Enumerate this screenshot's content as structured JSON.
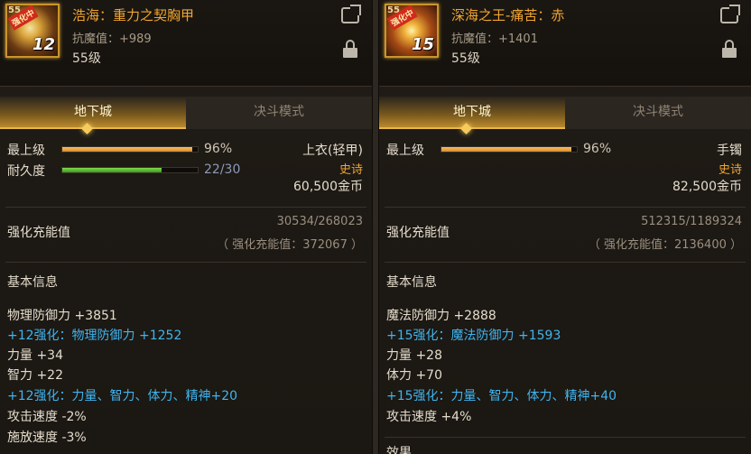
{
  "left": {
    "icon": {
      "tag": "强化中",
      "lvl": "55",
      "level": "12"
    },
    "name": "浩海：重力之契胸甲",
    "resistance": "抗魔值：+989",
    "required_level": "55级",
    "tabs": [
      "地下城",
      "决斗模式"
    ],
    "stats": {
      "top_level_label": "最上级",
      "top_level_percent": 0.96,
      "top_level_value": "96%",
      "durability_label": "耐久度",
      "durability_fraction": 0.7333,
      "durability_value": "22/30"
    },
    "slot": "上衣(轻甲)",
    "rarity": "史诗",
    "price": "60,500金币",
    "charge": {
      "label": "强化充能值",
      "progress": "30534/268023",
      "total": "（ 强化充能值：372067 ）"
    },
    "basic_info_title": "基本信息",
    "attributes": [
      {
        "text": "物理防御力 +3851",
        "color": "white"
      },
      {
        "text": "+12强化：物理防御力 +1252",
        "color": "blue"
      },
      {
        "text": "力量 +34",
        "color": "white"
      },
      {
        "text": "智力 +22",
        "color": "white"
      },
      {
        "text": "+12强化：力量、智力、体力、精神+20",
        "color": "blue"
      },
      {
        "text": "攻击速度 -2%",
        "color": "white"
      },
      {
        "text": "施放速度 -3%",
        "color": "white"
      }
    ]
  },
  "right": {
    "icon": {
      "tag": "强化中",
      "lvl": "55",
      "level": "15"
    },
    "name": "深海之王-痛苦：赤",
    "resistance": "抗魔值：+1401",
    "required_level": "55级",
    "tabs": [
      "地下城",
      "决斗模式"
    ],
    "stats": {
      "top_level_label": "最上级",
      "top_level_percent": 0.96,
      "top_level_value": "96%"
    },
    "slot": "手镯",
    "rarity": "史诗",
    "price": "82,500金币",
    "charge": {
      "label": "强化充能值",
      "progress": "512315/1189324",
      "total": "（ 强化充能值：2136400 ）"
    },
    "basic_info_title": "基本信息",
    "attributes": [
      {
        "text": "魔法防御力 +2888",
        "color": "white"
      },
      {
        "text": "+15强化：魔法防御力 +1593",
        "color": "blue"
      },
      {
        "text": "力量 +28",
        "color": "white"
      },
      {
        "text": "体力 +70",
        "color": "white"
      },
      {
        "text": "+15强化：力量、智力、体力、精神+40",
        "color": "blue"
      },
      {
        "text": "攻击速度 +4%",
        "color": "white"
      }
    ],
    "more_title": "效果"
  },
  "colors": {
    "name": "#f0a531",
    "blue_attr": "#3fb5f0",
    "rarity": "#f0a531"
  },
  "icons": [
    "share-icon",
    "lock-icon"
  ]
}
